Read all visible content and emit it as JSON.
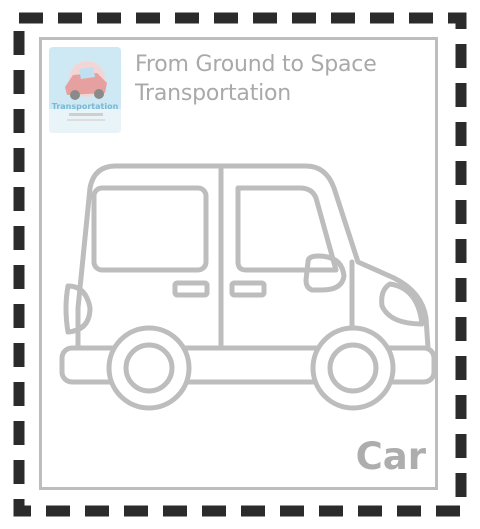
{
  "header": {
    "line1": "From Ground to Space",
    "line2": "Transportation"
  },
  "thumbnail": {
    "icon": "car-book-cover-thumbnail",
    "caption": "Transportation"
  },
  "drawing": {
    "icon": "car-outline-icon"
  },
  "label": "Car",
  "colors": {
    "outline": "#bdbdbd",
    "text": "#a9a9a9",
    "dash": "#2b2b2b"
  }
}
